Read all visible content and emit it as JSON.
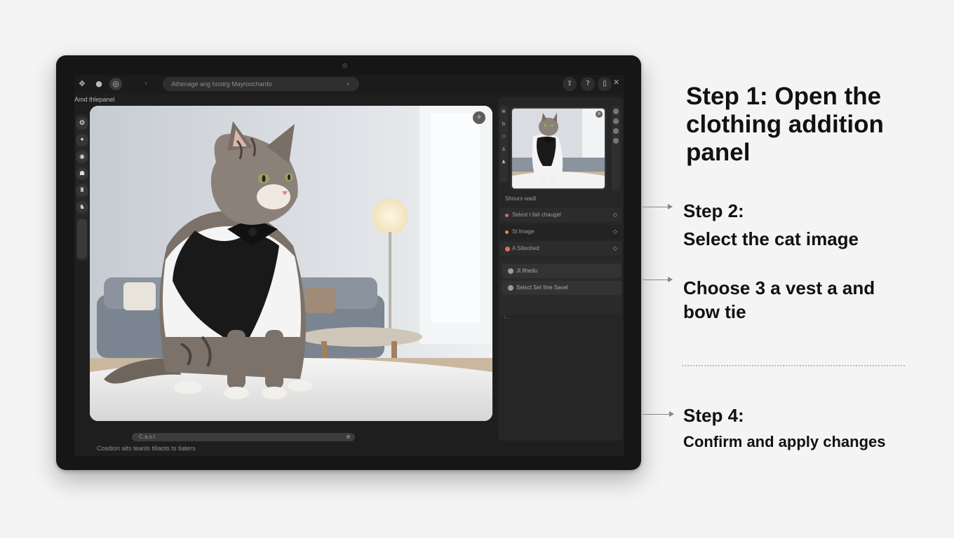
{
  "device": {
    "topbar": {
      "address_text": "Athenage ang hostrg Mayroochardo",
      "address_go": "⌕",
      "back_icon": "‹",
      "left_icons": [
        "move-icon",
        "brush-icon",
        "ai-icon"
      ],
      "right_icons": [
        "share-icon",
        "help-icon",
        "layout-icon"
      ],
      "close_icon": "✕"
    },
    "panel_title": "Amd thlepanel",
    "left_toolbar": {
      "icons": [
        "shirt-icon",
        "brush-icon",
        "layers-icon",
        "hat-icon",
        "bag-icon",
        "accessory-icon"
      ],
      "glyphs": [
        "❂",
        "✦",
        "◉",
        "☗",
        "♜",
        "♞"
      ]
    },
    "canvas": {
      "badge": "✧",
      "subject": "Cat wearing a black vest and bow tie"
    },
    "bottom_bar": {
      "text": "C.a.s.t",
      "end": "⊕"
    },
    "caption": "Cosdion aits teanls tlliaots ts tiaters",
    "right_panel": {
      "side_icons": [
        "⊛",
        "b",
        "♲",
        "♙",
        "♟"
      ],
      "thumb_badge": "⊘",
      "section_label": "Shours wadl",
      "options": [
        {
          "label": "Selest t fatl chaugel",
          "dot_color": "#d86a6a",
          "chevron": "◇"
        },
        {
          "label": "St lmage",
          "dot_color": "#e08a3a",
          "chevron": "◇"
        },
        {
          "label": "A Stleohed",
          "dot_color": "#e07050",
          "chevron": "◇"
        }
      ],
      "sub_options": [
        {
          "label": "Jt lthedu"
        },
        {
          "label": "Selsct Set fme Savel"
        }
      ],
      "tiny_text": "'l ...."
    }
  },
  "annotations": {
    "step1": "Step 1: Open the clothing addition panel",
    "step2_head": "Step 2:",
    "step2_body": "Select the cat image",
    "step3_line1": "Choose 3 a vest a and",
    "step3_line2": "bow tie",
    "step4_head": "Step 4:",
    "step4_body": "Confirm and apply changes"
  },
  "colors": {
    "page_bg": "#f4f4f4",
    "device_bezel": "#161616",
    "screen_bg": "#1e1e1e",
    "panel_bg": "#262626",
    "text_dark": "#111111"
  }
}
